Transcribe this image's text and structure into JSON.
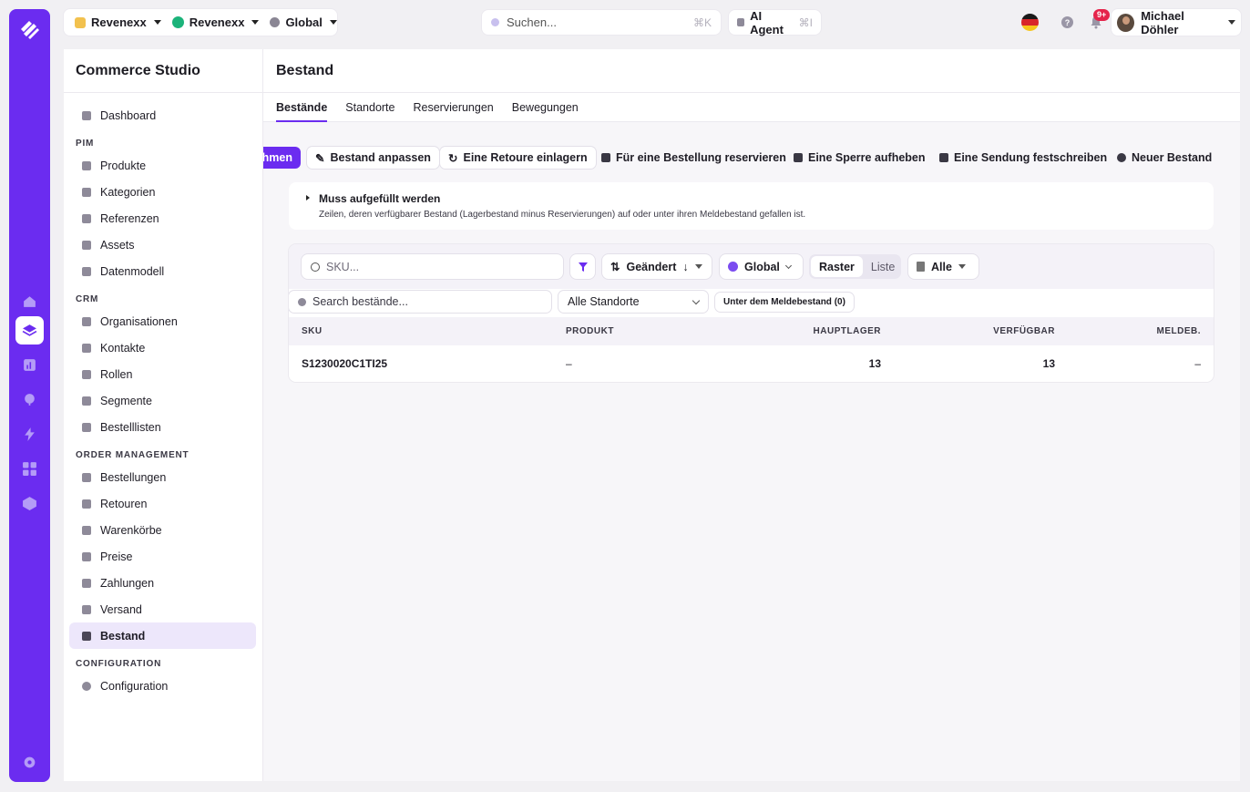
{
  "topbar": {
    "org": "Revenexx",
    "workspace": "Revenexx",
    "region": "Global",
    "search_placeholder": "Suchen...",
    "search_shortcut": "⌘K",
    "ai_label": "AI Agent",
    "ai_shortcut": "⌘I",
    "notifications_badge": "9+",
    "user_name": "Michael Döhler"
  },
  "colors": {
    "brand": "#6b2cf0",
    "badge": "#e5234a",
    "workspace_dot": "#1bb37a"
  },
  "sidebar": {
    "title": "Commerce Studio",
    "top_items": [
      {
        "label": "Dashboard",
        "icon": "dashboard-icon"
      }
    ],
    "sections": [
      {
        "title": "PIM",
        "items": [
          {
            "label": "Produkte",
            "icon": "cube-icon"
          },
          {
            "label": "Kategorien",
            "icon": "category-icon"
          },
          {
            "label": "Referenzen",
            "icon": "database-icon"
          },
          {
            "label": "Assets",
            "icon": "image-icon"
          },
          {
            "label": "Datenmodell",
            "icon": "grid-icon"
          }
        ]
      },
      {
        "title": "CRM",
        "items": [
          {
            "label": "Organisationen",
            "icon": "building-icon"
          },
          {
            "label": "Kontakte",
            "icon": "contact-icon"
          },
          {
            "label": "Rollen",
            "icon": "shield-icon"
          },
          {
            "label": "Segmente",
            "icon": "users-icon"
          },
          {
            "label": "Bestelllisten",
            "icon": "bookmark-icon"
          }
        ]
      },
      {
        "title": "ORDER MANAGEMENT",
        "items": [
          {
            "label": "Bestellungen",
            "icon": "order-icon"
          },
          {
            "label": "Retouren",
            "icon": "return-icon"
          },
          {
            "label": "Warenkörbe",
            "icon": "cart-icon"
          },
          {
            "label": "Preise",
            "icon": "tag-icon"
          },
          {
            "label": "Zahlungen",
            "icon": "card-icon"
          },
          {
            "label": "Versand",
            "icon": "truck-icon"
          },
          {
            "label": "Bestand",
            "icon": "cube-icon"
          }
        ]
      },
      {
        "title": "CONFIGURATION",
        "items": [
          {
            "label": "Configuration",
            "icon": "gear-icon"
          }
        ]
      }
    ]
  },
  "page": {
    "title": "Bestand",
    "tabs": [
      "Bestände",
      "Standorte",
      "Reservierungen",
      "Bewegungen"
    ]
  },
  "actions": {
    "primary_partial": "hmen",
    "adjust": "Bestand anpassen",
    "return": "Eine Retoure einlagern",
    "reserve": "Für eine Bestellung reservieren",
    "unlock": "Eine Sperre aufheben",
    "commit": "Eine Sendung festschreiben",
    "new": "Neuer Bestand"
  },
  "notice": {
    "title": "Muss aufgefüllt werden",
    "description": "Zeilen, deren verfügbarer Bestand (Lagerbestand minus Reservierungen) auf oder unter ihren Meldebestand gefallen ist."
  },
  "filters": {
    "sku_placeholder": "SKU...",
    "sort_label": "Geändert",
    "scope_label": "Global",
    "view_grid": "Raster",
    "view_list": "Liste",
    "filter_all": "Alle",
    "search_placeholder": "Search bestände...",
    "location_value": "Alle Standorte",
    "below_reorder": "Unter dem Meldebestand (0)"
  },
  "table": {
    "columns": [
      "SKU",
      "PRODUKT",
      "HAUPTLAGER",
      "VERFÜGBAR",
      "MELDEB."
    ],
    "rows": [
      {
        "sku": "S1230020C1TI25",
        "produkt": "–",
        "hauptlager": "13",
        "verfuegbar": "13",
        "meldeb": "–"
      }
    ]
  }
}
